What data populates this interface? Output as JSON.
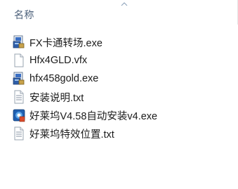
{
  "header": {
    "name_column": "名称"
  },
  "files": [
    {
      "name": "FX卡通转场.exe",
      "icon": "installer-exe-icon"
    },
    {
      "name": "Hfx4GLD.vfx",
      "icon": "blank-file-icon"
    },
    {
      "name": "hfx458gold.exe",
      "icon": "installer-exe-icon"
    },
    {
      "name": "安装说明.txt",
      "icon": "text-file-icon"
    },
    {
      "name": "好莱坞V4.58自动安装v4.exe",
      "icon": "app-exe-icon"
    },
    {
      "name": "好莱坞特效位置.txt",
      "icon": "text-file-icon"
    }
  ]
}
